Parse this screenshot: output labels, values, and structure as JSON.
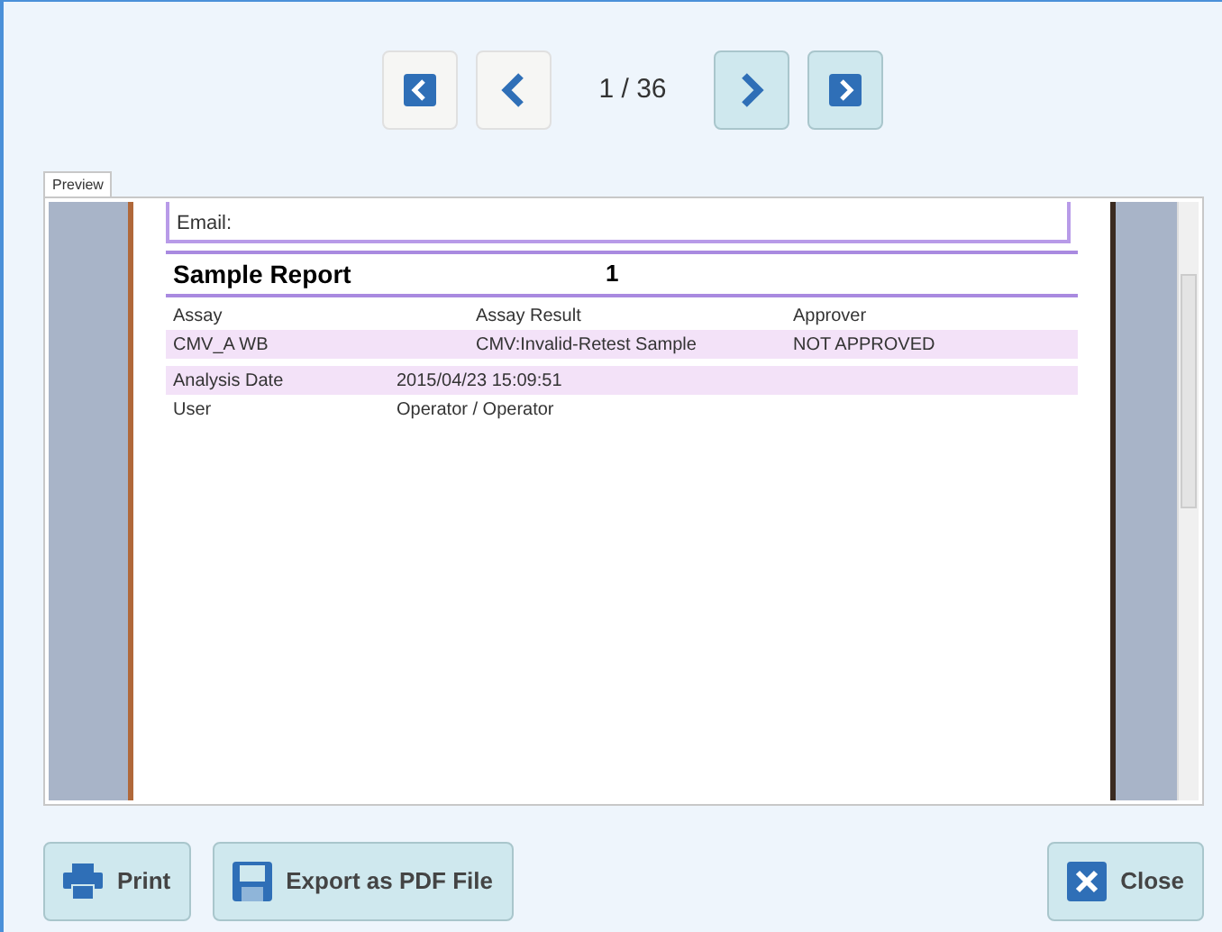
{
  "navigation": {
    "buttons": [
      {
        "kind": "first",
        "disabled": true
      },
      {
        "kind": "previous",
        "disabled": true
      },
      {
        "kind": "next",
        "disabled": false
      },
      {
        "kind": "last",
        "disabled": false
      }
    ],
    "page_indicator": "1 / 36"
  },
  "tabs": [
    {
      "label": "Preview",
      "selected": true
    }
  ],
  "report": {
    "contact_fields": [
      "Email:"
    ],
    "title": "Sample Report",
    "number": "1",
    "assay_header": [
      "Assay",
      "Assay Result",
      "Approver"
    ],
    "assay_row": [
      "CMV_A WB",
      "CMV:Invalid-Retest Sample",
      "NOT APPROVED"
    ],
    "details": [
      {
        "label": "Analysis Date",
        "value": "2015/04/23 15:09:51",
        "highlighted": true
      },
      {
        "label": "User",
        "value": "Operator / Operator",
        "highlighted": false
      }
    ]
  },
  "actions": [
    {
      "kind": "print",
      "label": "Print"
    },
    {
      "kind": "export",
      "label": "Export as PDF File"
    },
    {
      "kind": "close",
      "label": "Close"
    }
  ]
}
